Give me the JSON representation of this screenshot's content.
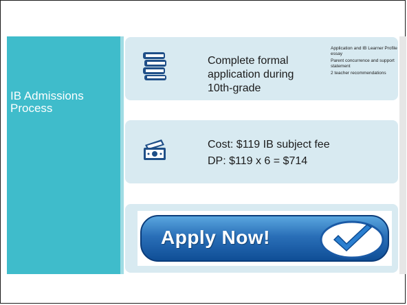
{
  "slide": {
    "title": "IB Admissions Process",
    "colors": {
      "band": "#3fbccb",
      "row": "#d8eaf1",
      "accent": "#2a6fb8"
    },
    "rows": [
      {
        "icon": "books-icon",
        "text": "Complete formal application during 10th-grade",
        "notes": [
          "Application and IB Learner Profile essay",
          "Parent concurrence and support statement",
          "2 teacher recommendations"
        ]
      },
      {
        "icon": "money-icon",
        "line1": "Cost:   $119 IB subject fee",
        "line2": "DP: $119 x 6 = $714"
      },
      {
        "button_label": "Apply Now!",
        "icon": "checkmark-icon"
      }
    ]
  }
}
